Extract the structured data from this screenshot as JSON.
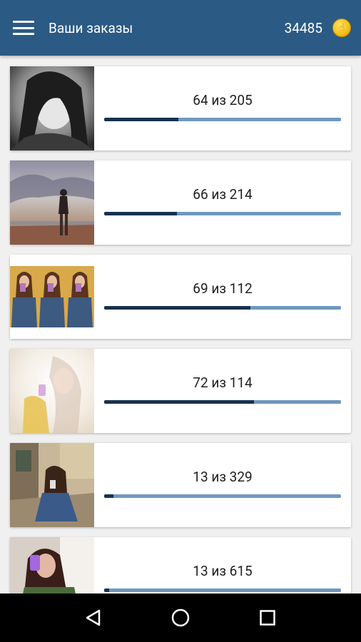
{
  "toolbar": {
    "menu_icon": "hamburger-menu-icon",
    "title": "Ваши заказы",
    "balance": "34485",
    "coin_icon": "coin-icon",
    "coin_color": "#f6c21b"
  },
  "colors": {
    "toolbar_bg": "#2b5a84",
    "progress_fill": "#17324f",
    "progress_track": "#6f98bf"
  },
  "orders": [
    {
      "progress_text": "64 из 205",
      "done": 64,
      "total": 205
    },
    {
      "progress_text": "66 из 214",
      "done": 66,
      "total": 214
    },
    {
      "progress_text": "69 из 112",
      "done": 69,
      "total": 112
    },
    {
      "progress_text": "72 из 114",
      "done": 72,
      "total": 114
    },
    {
      "progress_text": "13 из 329",
      "done": 13,
      "total": 329
    },
    {
      "progress_text": "13 из 615",
      "done": 13,
      "total": 615
    }
  ],
  "navbar": {
    "back_icon": "back-triangle-icon",
    "home_icon": "home-circle-icon",
    "recents_icon": "recents-square-icon"
  }
}
